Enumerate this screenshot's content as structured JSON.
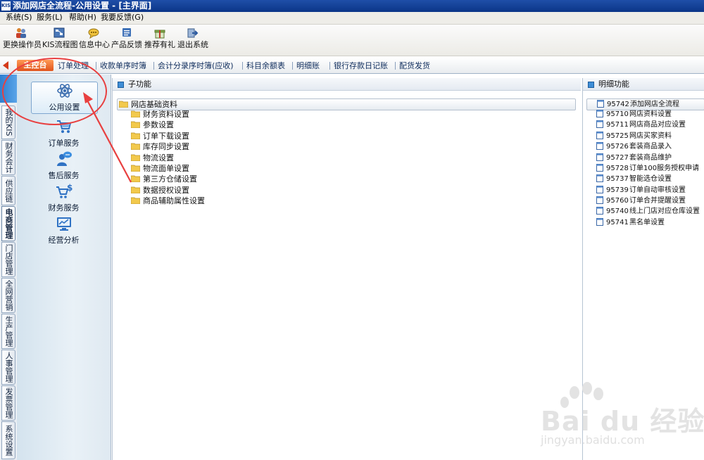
{
  "window": {
    "app_icon": "KIS",
    "title": "添加网店全流程-公用设置 - [主界面]"
  },
  "menu": [
    "系统(S)",
    "服务(L)",
    "帮助(H)",
    "我要反馈(G)"
  ],
  "toolbar": [
    {
      "label": "更换操作员",
      "icon": "users-icon"
    },
    {
      "label": "KIS流程图",
      "icon": "flowchart-icon"
    },
    {
      "label": "信息中心",
      "icon": "message-icon"
    },
    {
      "label": "产品反馈",
      "icon": "feedback-icon"
    },
    {
      "label": "推荐有礼",
      "icon": "gift-icon"
    },
    {
      "label": "退出系统",
      "icon": "exit-icon"
    }
  ],
  "tabs": {
    "active": "主控台",
    "items": [
      "订单处理",
      "收款单序时簿",
      "会计分录序时簿(应收)",
      "科目余额表",
      "明细账",
      "银行存款日记账",
      "配货发货"
    ]
  },
  "side_tabs": [
    "我的KIS",
    "财务会计",
    "供应链",
    "电商管理",
    "门店管理",
    "全网营销",
    "生产管理",
    "人事管理",
    "发票管理",
    "系统设置"
  ],
  "modules": [
    {
      "label": "公用设置",
      "icon": "atom-icon",
      "selected": true
    },
    {
      "label": "订单服务",
      "icon": "cart-icon"
    },
    {
      "label": "售后服务",
      "icon": "service-person-icon"
    },
    {
      "label": "财务服务",
      "icon": "cart-dollar-icon"
    },
    {
      "label": "经营分析",
      "icon": "chart-monitor-icon"
    }
  ],
  "sub_panel": {
    "title": "子功能",
    "root": "网店基础资料",
    "items": [
      "财务资料设置",
      "参数设置",
      "订单下载设置",
      "库存同步设置",
      "物流设置",
      "物流面单设置",
      "第三方仓储设置",
      "数据授权设置",
      "商品辅助属性设置"
    ]
  },
  "detail_panel": {
    "title": "明细功能",
    "rows": [
      {
        "code": "95742",
        "name": "添加网店全流程"
      },
      {
        "code": "95710",
        "name": "网店资料设置"
      },
      {
        "code": "95711",
        "name": "网店商品对应设置"
      },
      {
        "code": "95725",
        "name": "网店买家资料"
      },
      {
        "code": "95726",
        "name": "套装商品录入"
      },
      {
        "code": "95727",
        "name": "套装商品维护"
      },
      {
        "code": "95728",
        "name": "订单100服务授权申请"
      },
      {
        "code": "95737",
        "name": "智能选仓设置"
      },
      {
        "code": "95739",
        "name": "订单自动审核设置"
      },
      {
        "code": "95760",
        "name": "订单合并提醒设置"
      },
      {
        "code": "95740",
        "name": "线上门店对应仓库设置"
      },
      {
        "code": "95741",
        "name": "黑名单设置"
      }
    ]
  },
  "watermark": {
    "brand_text": "Bai du 经验",
    "url": "jingyan.baidu.com"
  },
  "colors": {
    "title_bar": "#0b3587",
    "active_tab": "#e0541c",
    "annotation": "#e84040"
  }
}
